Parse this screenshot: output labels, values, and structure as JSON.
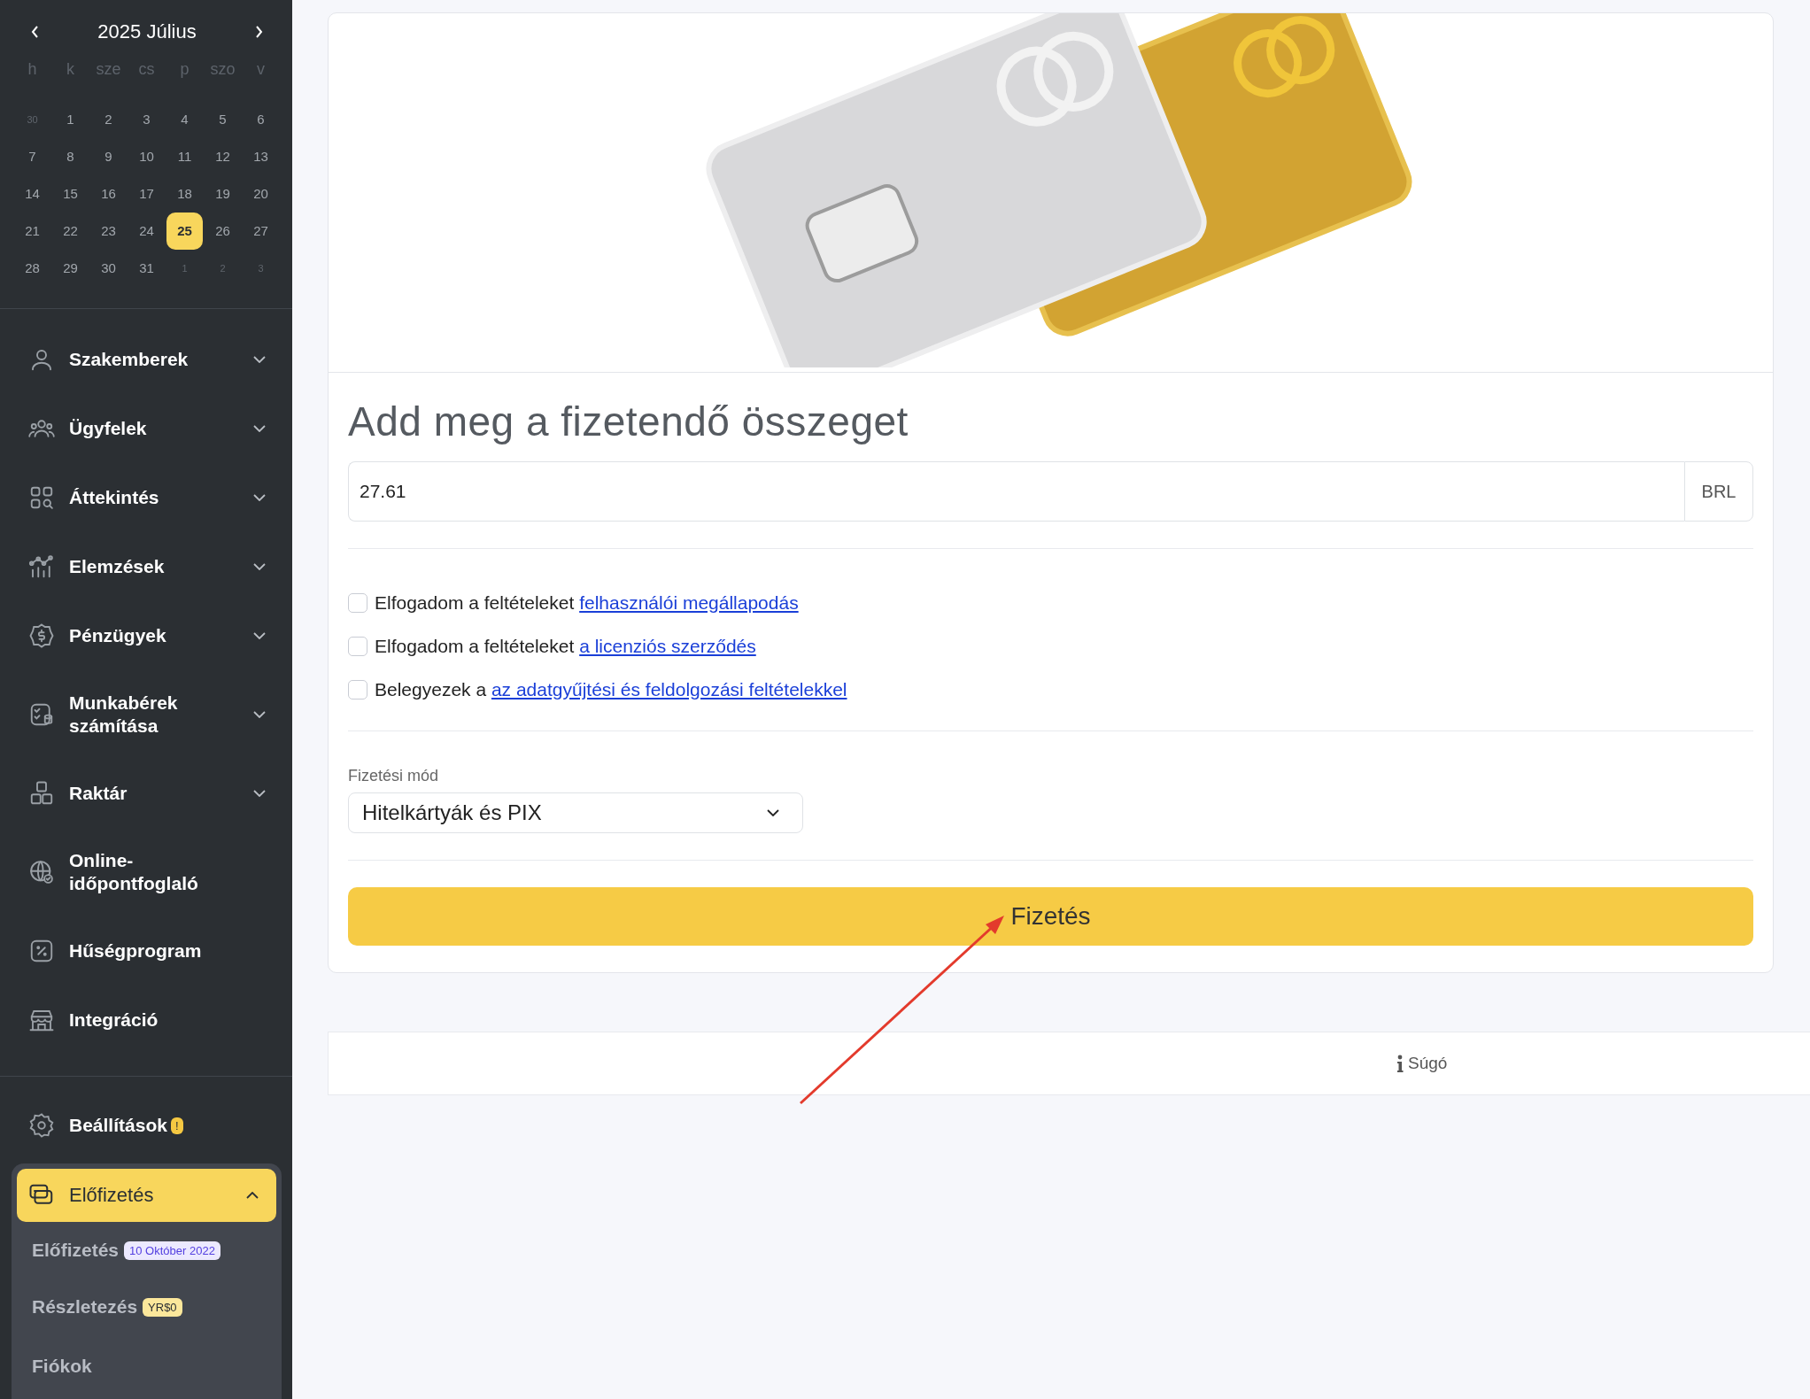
{
  "calendar": {
    "title": "2025 Július",
    "weekdays": [
      "h",
      "k",
      "sze",
      "cs",
      "p",
      "szo",
      "v"
    ],
    "days": [
      {
        "d": "30",
        "outside": true,
        "selected": false
      },
      {
        "d": "1",
        "outside": false,
        "selected": false
      },
      {
        "d": "2",
        "outside": false,
        "selected": false
      },
      {
        "d": "3",
        "outside": false,
        "selected": false
      },
      {
        "d": "4",
        "outside": false,
        "selected": false
      },
      {
        "d": "5",
        "outside": false,
        "selected": false
      },
      {
        "d": "6",
        "outside": false,
        "selected": false
      },
      {
        "d": "7",
        "outside": false,
        "selected": false
      },
      {
        "d": "8",
        "outside": false,
        "selected": false
      },
      {
        "d": "9",
        "outside": false,
        "selected": false
      },
      {
        "d": "10",
        "outside": false,
        "selected": false
      },
      {
        "d": "11",
        "outside": false,
        "selected": false
      },
      {
        "d": "12",
        "outside": false,
        "selected": false
      },
      {
        "d": "13",
        "outside": false,
        "selected": false
      },
      {
        "d": "14",
        "outside": false,
        "selected": false
      },
      {
        "d": "15",
        "outside": false,
        "selected": false
      },
      {
        "d": "16",
        "outside": false,
        "selected": false
      },
      {
        "d": "17",
        "outside": false,
        "selected": false
      },
      {
        "d": "18",
        "outside": false,
        "selected": false
      },
      {
        "d": "19",
        "outside": false,
        "selected": false
      },
      {
        "d": "20",
        "outside": false,
        "selected": false
      },
      {
        "d": "21",
        "outside": false,
        "selected": false
      },
      {
        "d": "22",
        "outside": false,
        "selected": false
      },
      {
        "d": "23",
        "outside": false,
        "selected": false
      },
      {
        "d": "24",
        "outside": false,
        "selected": false
      },
      {
        "d": "25",
        "outside": false,
        "selected": true
      },
      {
        "d": "26",
        "outside": false,
        "selected": false
      },
      {
        "d": "27",
        "outside": false,
        "selected": false
      },
      {
        "d": "28",
        "outside": false,
        "selected": false
      },
      {
        "d": "29",
        "outside": false,
        "selected": false
      },
      {
        "d": "30",
        "outside": false,
        "selected": false
      },
      {
        "d": "31",
        "outside": false,
        "selected": false
      },
      {
        "d": "1",
        "outside": true,
        "selected": false
      },
      {
        "d": "2",
        "outside": true,
        "selected": false
      },
      {
        "d": "3",
        "outside": true,
        "selected": false
      }
    ]
  },
  "nav": [
    {
      "kind": "person",
      "label": "Szakemberek",
      "expandable": true
    },
    {
      "kind": "people",
      "label": "Ügyfelek",
      "expandable": true
    },
    {
      "kind": "grid",
      "label": "Áttekintés",
      "expandable": true
    },
    {
      "kind": "chart",
      "label": "Elemzések",
      "expandable": true
    },
    {
      "kind": "dollar",
      "label": "Pénzügyek",
      "expandable": true
    },
    {
      "kind": "payroll",
      "label": "Munkabérek számítása",
      "expandable": true
    },
    {
      "kind": "boxes",
      "label": "Raktár",
      "expandable": true
    },
    {
      "kind": "globe",
      "label": "Online-időpontfoglaló",
      "expandable": false
    },
    {
      "kind": "percent",
      "label": "Hűségprogram",
      "expandable": false
    },
    {
      "kind": "store",
      "label": "Integráció",
      "expandable": false
    }
  ],
  "settings": {
    "label": "Beállítások",
    "badge": "!"
  },
  "subscription": {
    "label": "Előfizetés",
    "expanded": true,
    "children": [
      {
        "label": "Előfizetés",
        "badge": "10 Október 2022",
        "kind": "date"
      },
      {
        "label": "Részletezés",
        "badge": "YR$0",
        "kind": "price"
      },
      {
        "label": "Fiókok"
      }
    ]
  },
  "payment": {
    "heading": "Add meg a fizetendő összeget",
    "amount": "27.61",
    "currency": "BRL",
    "agreements": [
      {
        "text": "Elfogadom a feltételeket",
        "link": "felhasználói megállapodás",
        "checked": false
      },
      {
        "text": "Elfogadom a feltételeket",
        "link": "a licenziós szerződés",
        "checked": false
      },
      {
        "text": "Belegyezek a",
        "link": "az adatgyűjtési és feldolgozási feltételekkel",
        "checked": false
      }
    ],
    "method_label": "Fizetési mód",
    "method": "Hitelkártyák és PIX",
    "pay_button": "Fizetés"
  },
  "help": {
    "label": "Súgó"
  }
}
